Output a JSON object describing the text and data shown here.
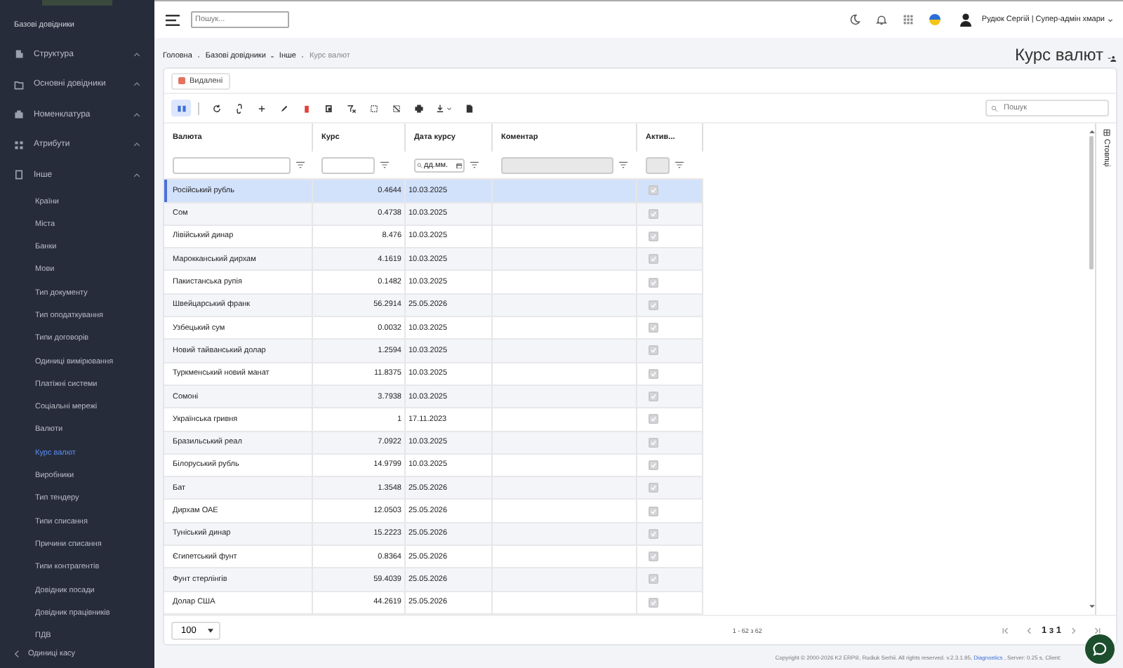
{
  "sidebar": {
    "section_label": "Базові довідники",
    "groups": [
      {
        "label": "Структура"
      },
      {
        "label": "Основні довідники"
      },
      {
        "label": "Номенклатура"
      },
      {
        "label": "Атрибути"
      },
      {
        "label": "Інше",
        "children": [
          {
            "label": "Країни",
            "selected": false
          },
          {
            "label": "Міста",
            "selected": false
          },
          {
            "label": "Банки",
            "selected": false
          },
          {
            "label": "Мови",
            "selected": false
          },
          {
            "label": "Тип документу",
            "selected": false
          },
          {
            "label": "Тип оподаткування",
            "selected": false
          },
          {
            "label": "Типи договорів",
            "selected": false
          },
          {
            "label": "Одиниці вимірювання",
            "selected": false
          },
          {
            "label": "Платіжні системи",
            "selected": false
          },
          {
            "label": "Соціальні мережі",
            "selected": false
          },
          {
            "label": "Валюти",
            "selected": false
          },
          {
            "label": "Курс валют",
            "selected": true
          },
          {
            "label": "Виробники",
            "selected": false
          },
          {
            "label": "Тип тендеру",
            "selected": false
          },
          {
            "label": "Типи списання",
            "selected": false
          },
          {
            "label": "Причини списання",
            "selected": false
          },
          {
            "label": "Типи контрагентів",
            "selected": false
          },
          {
            "label": "Довідник посади",
            "selected": false
          },
          {
            "label": "Довідник працівників",
            "selected": false
          },
          {
            "label": "ПДВ",
            "selected": false
          }
        ]
      }
    ],
    "bottom_item": "Одиниці касу"
  },
  "header": {
    "search": {
      "placeholder": "Пошук..."
    },
    "user": "Рудюк Сергій | Супер-адмін хмари"
  },
  "breadcrumb": [
    "Головна",
    "Базові довідники",
    "Інше",
    "Курс валют"
  ],
  "page_title": "Курс валют",
  "deleted_button": "Видалені",
  "toolbar_search": {
    "placeholder": "Пошук"
  },
  "table": {
    "columns": [
      "Валюта",
      "Курс",
      "Дата курсу",
      "Коментар",
      "Актив..."
    ],
    "date_filter_placeholder": "дд.мм.",
    "rows": [
      {
        "currency": "Російський рубль",
        "rate": "0.4644",
        "date": "10.03.2025",
        "active": true,
        "selected": true
      },
      {
        "currency": "Сом",
        "rate": "0.4738",
        "date": "10.03.2025",
        "active": true,
        "selected": false
      },
      {
        "currency": "Лівійський динар",
        "rate": "8.476",
        "date": "10.03.2025",
        "active": true,
        "selected": false
      },
      {
        "currency": "Марокканський дирхам",
        "rate": "4.1619",
        "date": "10.03.2025",
        "active": true,
        "selected": false
      },
      {
        "currency": "Пакистанська рупія",
        "rate": "0.1482",
        "date": "10.03.2025",
        "active": true,
        "selected": false
      },
      {
        "currency": "Швейцарський франк",
        "rate": "56.2914",
        "date": "25.05.2026",
        "active": true,
        "selected": false
      },
      {
        "currency": "Узбецький сум",
        "rate": "0.0032",
        "date": "10.03.2025",
        "active": true,
        "selected": false
      },
      {
        "currency": "Новий тайванський долар",
        "rate": "1.2594",
        "date": "10.03.2025",
        "active": true,
        "selected": false
      },
      {
        "currency": "Туркменський новий манат",
        "rate": "11.8375",
        "date": "10.03.2025",
        "active": true,
        "selected": false
      },
      {
        "currency": "Сомоні",
        "rate": "3.7938",
        "date": "10.03.2025",
        "active": true,
        "selected": false
      },
      {
        "currency": "Українська гривня",
        "rate": "1",
        "date": "17.11.2023",
        "active": true,
        "selected": false
      },
      {
        "currency": "Бразильський реал",
        "rate": "7.0922",
        "date": "10.03.2025",
        "active": true,
        "selected": false
      },
      {
        "currency": "Білоруський рубль",
        "rate": "14.9799",
        "date": "10.03.2025",
        "active": true,
        "selected": false
      },
      {
        "currency": "Бат",
        "rate": "1.3548",
        "date": "25.05.2026",
        "active": true,
        "selected": false
      },
      {
        "currency": "Дирхам ОАЕ",
        "rate": "12.0503",
        "date": "25.05.2026",
        "active": true,
        "selected": false
      },
      {
        "currency": "Туніський динар",
        "rate": "15.2223",
        "date": "25.05.2026",
        "active": true,
        "selected": false
      },
      {
        "currency": "Єгипетський фунт",
        "rate": "0.8364",
        "date": "25.05.2026",
        "active": true,
        "selected": false
      },
      {
        "currency": "Фунт стерлінгів",
        "rate": "59.4039",
        "date": "25.05.2026",
        "active": true,
        "selected": false
      },
      {
        "currency": "Долар США",
        "rate": "44.2619",
        "date": "25.05.2026",
        "active": true,
        "selected": false
      }
    ]
  },
  "columns_panel": "Стовпці",
  "pager": {
    "page_size": "100",
    "range": "1 - 62 з 62",
    "page": "1 з 1"
  },
  "footer": {
    "text": "Copyright © 2000-2026 K2 ERP®, Rudiuk Serhii. All rights reserved. v.2.3.1.95,",
    "link": "Diagnostics",
    "tail": ", Server: 0.25 s, Client:"
  }
}
